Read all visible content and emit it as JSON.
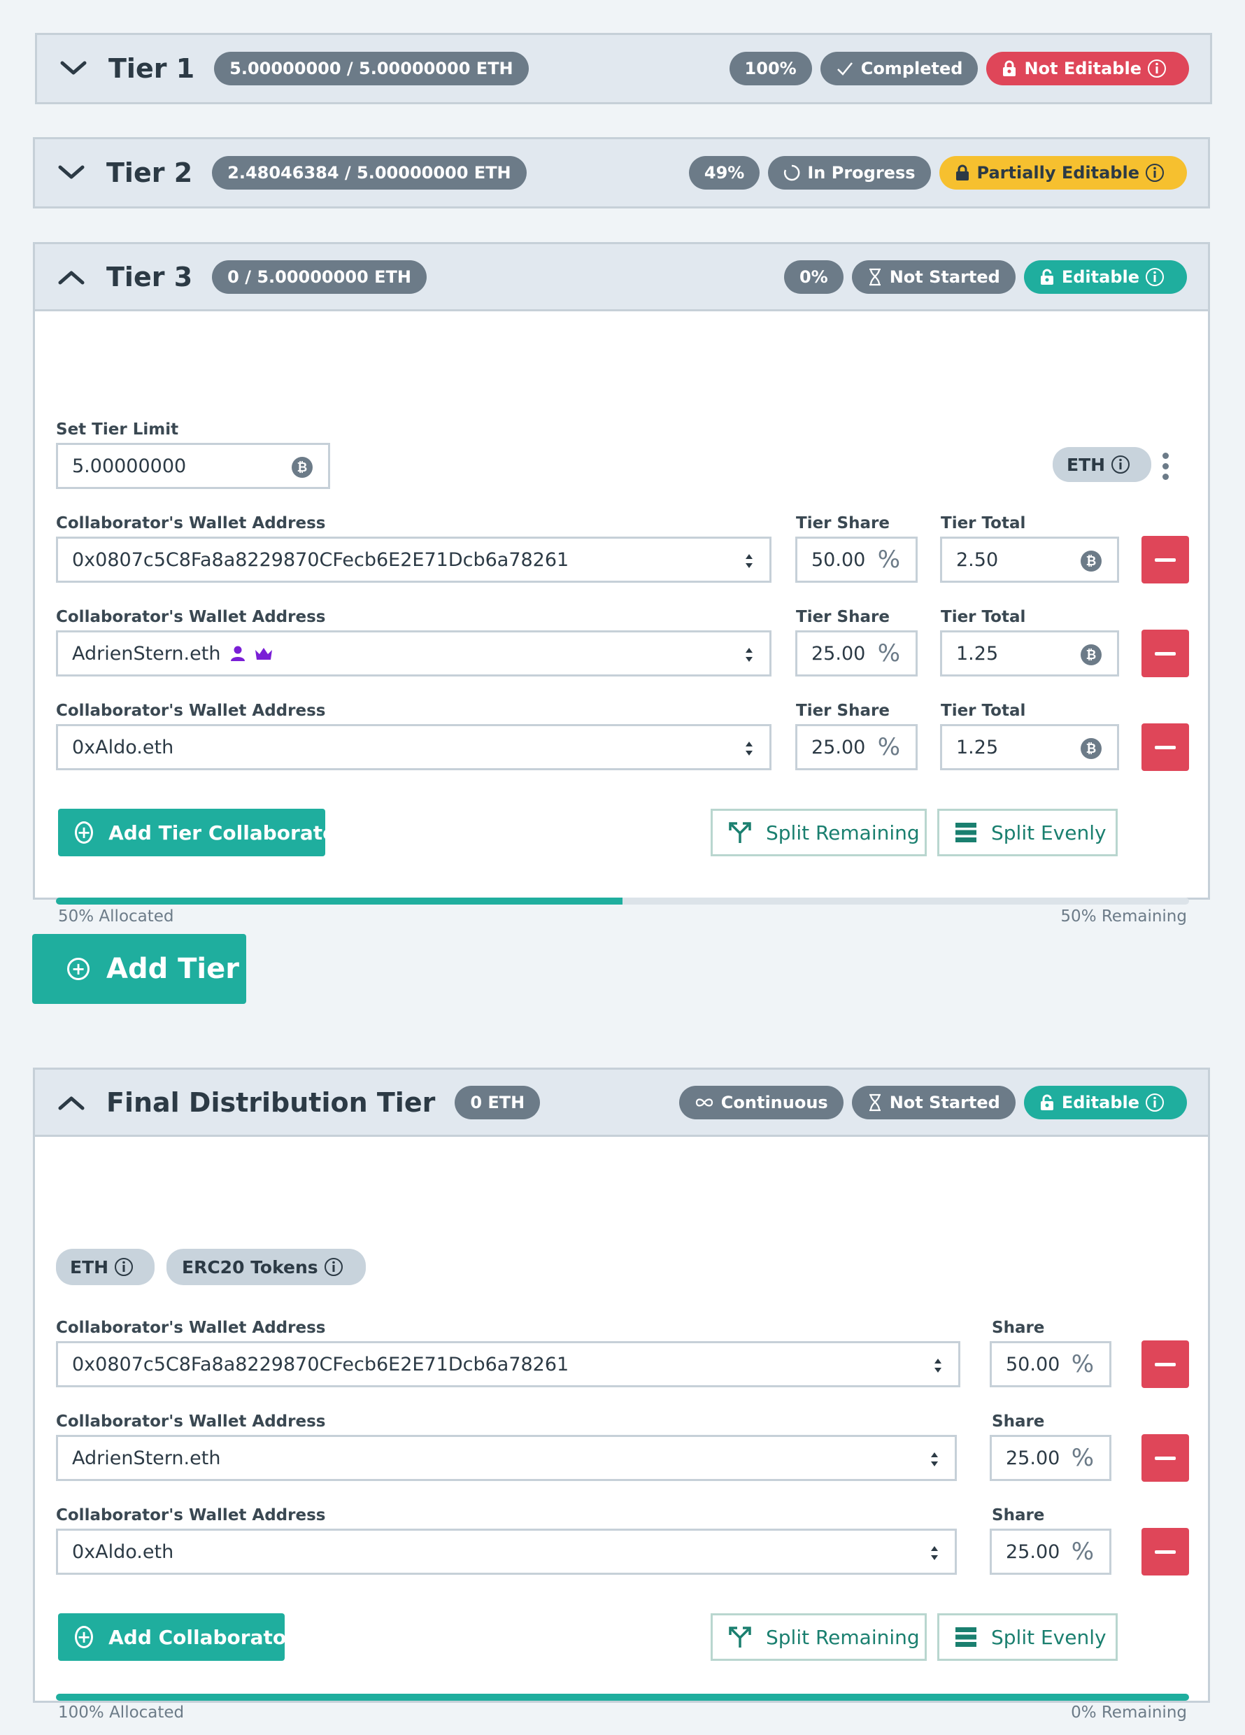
{
  "tiers": [
    {
      "title": "Tier 1",
      "amount": "5.00000000 / 5.00000000 ETH",
      "percent": "100%",
      "status": "Completed",
      "edit": "Not Editable"
    },
    {
      "title": "Tier 2",
      "amount": "2.48046384 / 5.00000000 ETH",
      "percent": "49%",
      "status": "In Progress",
      "edit": "Partially Editable"
    },
    {
      "title": "Tier 3",
      "amount": "0 / 5.00000000 ETH",
      "percent": "0%",
      "status": "Not Started",
      "edit": "Editable"
    }
  ],
  "tier3": {
    "limit_label": "Set Tier Limit",
    "limit_value": "5.00000000",
    "currency_badge": "ETH",
    "wallet_label": "Collaborator's Wallet Address",
    "share_label": "Tier Share",
    "total_label": "Tier Total",
    "rows": [
      {
        "address": "0x0807c5C8Fa8a8229870CFecb6E2E71Dcb6a78261",
        "share": "50.00",
        "total": "2.50"
      },
      {
        "address": "AdrienStern.eth",
        "share": "25.00",
        "total": "1.25"
      },
      {
        "address": "0xAldo.eth",
        "share": "25.00",
        "total": "1.25"
      }
    ],
    "add_button": "Add Tier Collaborator",
    "split_remaining": "Split Remaining",
    "split_evenly": "Split Evenly",
    "allocated_fraction": 0.5,
    "allocated_label": "50% Allocated",
    "remaining_label": "50% Remaining"
  },
  "add_tier": "Add Tier",
  "final": {
    "title": "Final Distribution Tier",
    "amount": "0 ETH",
    "mode": "Continuous",
    "status": "Not Started",
    "edit": "Editable",
    "token_eth": "ETH",
    "token_erc20": "ERC20 Tokens",
    "wallet_label": "Collaborator's Wallet Address",
    "share_label": "Share",
    "rows": [
      {
        "address": "0x0807c5C8Fa8a8229870CFecb6E2E71Dcb6a78261",
        "share": "50.00"
      },
      {
        "address": "AdrienStern.eth",
        "share": "25.00"
      },
      {
        "address": "0xAldo.eth",
        "share": "25.00"
      }
    ],
    "add_button": "Add Collaborator",
    "split_remaining": "Split Remaining",
    "split_evenly": "Split Evenly",
    "allocated_fraction": 1.0,
    "allocated_label": "100% Allocated",
    "remaining_label": "0% Remaining"
  },
  "colors": {
    "teal": "#1fae9e",
    "red": "#df4659",
    "yellow": "#f6c02f",
    "gray": "#6c7b88",
    "purple": "#7a1fd6"
  }
}
